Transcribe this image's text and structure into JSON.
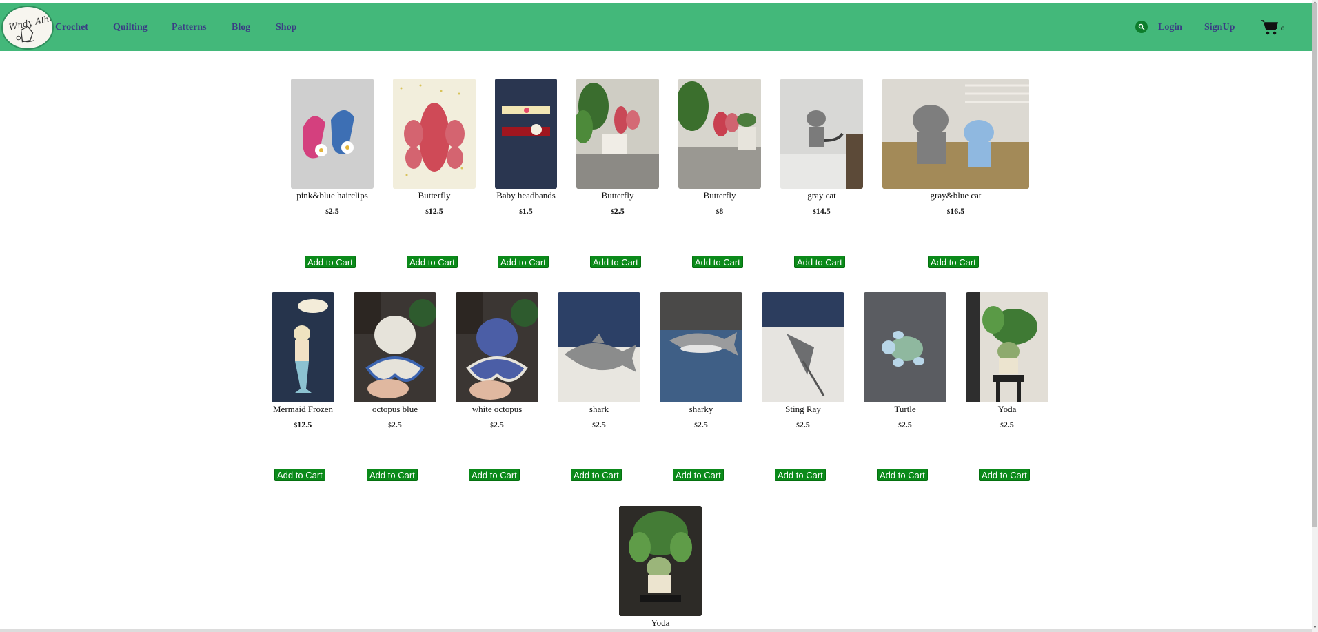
{
  "nav": {
    "logo_text": "Wendy Alhara",
    "links": [
      "Crochet",
      "Quilting",
      "Patterns",
      "Blog",
      "Shop"
    ],
    "login": "Login",
    "signup": "SignUp",
    "cart_count": "0",
    "brand_color": "#43b87a",
    "link_color": "#3a3c84"
  },
  "currency": "$",
  "add_label": "Add to Cart",
  "products": [
    {
      "name": "pink&blue hairclips",
      "price": "2.5",
      "icon": "hairclips-photo"
    },
    {
      "name": "Butterfly",
      "price": "12.5",
      "icon": "butterfly-photo"
    },
    {
      "name": "Baby headbands",
      "price": "1.5",
      "icon": "headbands-photo"
    },
    {
      "name": "Butterfly",
      "price": "2.5",
      "icon": "butterfly-plant-photo"
    },
    {
      "name": "Butterfly",
      "price": "8",
      "icon": "butterfly-shelf-photo"
    },
    {
      "name": "gray cat",
      "price": "14.5",
      "icon": "gray-cat-photo"
    },
    {
      "name": "gray&blue cat",
      "price": "16.5",
      "icon": "cats-photo"
    },
    {
      "name": "Mermaid Frozen",
      "price": "12.5",
      "icon": "mermaid-photo"
    },
    {
      "name": "octopus blue",
      "price": "2.5",
      "icon": "octopus-white-photo"
    },
    {
      "name": "white octopus",
      "price": "2.5",
      "icon": "octopus-blue-photo"
    },
    {
      "name": "shark",
      "price": "2.5",
      "icon": "shark-photo"
    },
    {
      "name": "sharky",
      "price": "2.5",
      "icon": "sharky-photo"
    },
    {
      "name": "Sting Ray",
      "price": "2.5",
      "icon": "stingray-photo"
    },
    {
      "name": "Turtle",
      "price": "2.5",
      "icon": "turtle-photo"
    },
    {
      "name": "Yoda",
      "price": "2.5",
      "icon": "yoda-photo"
    },
    {
      "name": "Yoda",
      "price": "",
      "icon": "yoda-large-photo"
    }
  ]
}
